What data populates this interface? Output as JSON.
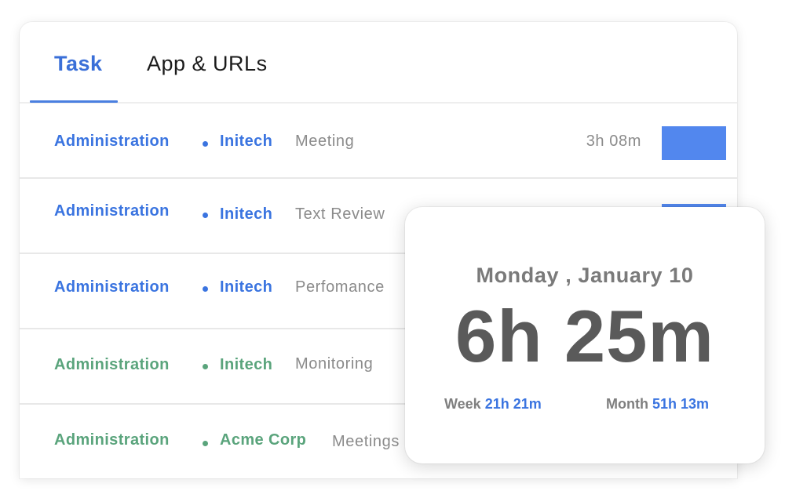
{
  "tabs": [
    {
      "label": "Task",
      "active": true
    },
    {
      "label": "App & URLs",
      "active": false
    }
  ],
  "colors": {
    "accent_blue": "#3a74e0",
    "accent_green": "#5aa47c",
    "bar_blue": "#5287ee",
    "muted_text": "#8b8b8b"
  },
  "rows": [
    {
      "project": "Administration",
      "client": "Initech",
      "task": "Meeting",
      "duration": "3h 08m",
      "color": "blue"
    },
    {
      "project": "Administration",
      "client": "Initech",
      "task": "Text Review",
      "duration": "",
      "color": "blue"
    },
    {
      "project": "Administration",
      "client": "Initech",
      "task": "Perfomance",
      "duration": "",
      "color": "blue"
    },
    {
      "project": "Administration",
      "client": "Initech",
      "task": "Monitoring",
      "duration": "",
      "color": "green"
    },
    {
      "project": "Administration",
      "client": "Acme Corp",
      "task": "Meetings",
      "duration": "",
      "color": "green"
    }
  ],
  "summary": {
    "date": "Monday , January 10",
    "total": "6h 25m",
    "week_label": "Week",
    "week_value": "21h 21m",
    "month_label": "Month",
    "month_value": "51h 13m"
  }
}
